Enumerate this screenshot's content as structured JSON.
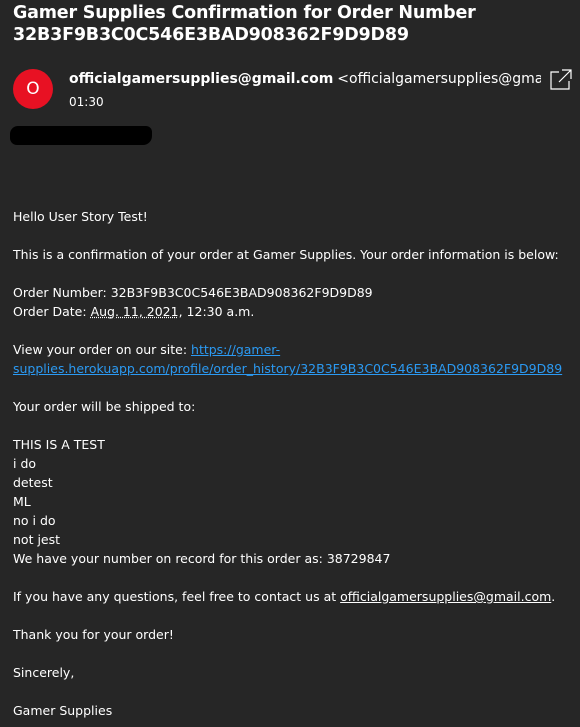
{
  "message": {
    "subject_line1": "Gamer Supplies Confirmation for Order Number",
    "subject_line2": "32B3F9B3C0C546E3BAD908362F9D9D89",
    "avatar_letter": "O",
    "avatar_color": "#e81123",
    "sender_name": "officialgamersupplies@gmail.com",
    "sender_address": "<officialgamersupplies@gmail.com>",
    "time": "01:30",
    "popout_icon": "open-in-new-window-icon"
  },
  "body": {
    "greeting": "Hello User Story Test!",
    "intro": "This is a confirmation of your order at Gamer Supplies. Your order information is below:",
    "order_number_label": "Order Number: ",
    "order_number": "32B3F9B3C0C546E3BAD908362F9D9D89",
    "order_date_label": "Order Date: ",
    "order_date": "Aug. 11, 2021",
    "order_time": ", 12:30 a.m.",
    "view_label": "View your order on our site: ",
    "view_link_line1": "https://gamer-",
    "view_link_line2": "supplies.herokuapp.com/profile/order_history/32B3F9B3C0C546E3BAD908362F9D9D89",
    "ship_intro": "Your order will be shipped to:",
    "address_lines": [
      "THIS IS A TEST",
      "i do",
      "detest",
      "ML",
      "no i do",
      "not jest"
    ],
    "phone_text": "We have your number on record for this order as: 38729847",
    "contact_text": "If you have any questions, feel free to contact us at ",
    "contact_email": "officialgamersupplies@gmail.com",
    "contact_end": ".",
    "thanks": "Thank you for your order!",
    "closing": "Sincerely,",
    "signature": "Gamer Supplies"
  },
  "colors": {
    "background": "#262626",
    "text": "#ffffff",
    "link": "#2b9af3"
  }
}
